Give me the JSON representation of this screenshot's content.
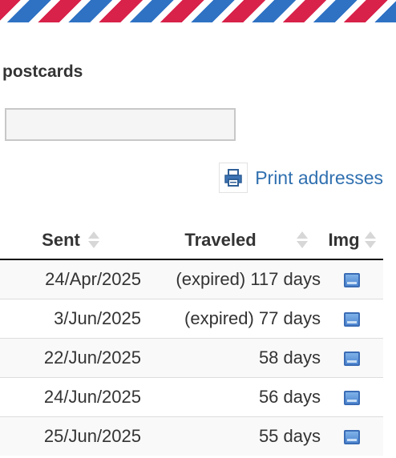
{
  "header": {
    "title": "postcards"
  },
  "search": {
    "value": "",
    "placeholder": ""
  },
  "actions": {
    "print_label": "Print addresses",
    "print_icon": "printer-icon"
  },
  "table": {
    "columns": [
      "Sent",
      "Traveled",
      "Img"
    ],
    "rows": [
      {
        "sent": "24/Apr/2025",
        "traveled": "(expired) 117 days",
        "img": "image-icon"
      },
      {
        "sent": "3/Jun/2025",
        "traveled": "(expired) 77 days",
        "img": "image-icon"
      },
      {
        "sent": "22/Jun/2025",
        "traveled": "58 days",
        "img": "image-icon"
      },
      {
        "sent": "24/Jun/2025",
        "traveled": "56 days",
        "img": "image-icon"
      },
      {
        "sent": "25/Jun/2025",
        "traveled": "55 days",
        "img": "image-icon"
      }
    ]
  },
  "colors": {
    "airmail_blue": "#2f72c4",
    "airmail_red": "#d8224a",
    "link": "#3070b0"
  }
}
